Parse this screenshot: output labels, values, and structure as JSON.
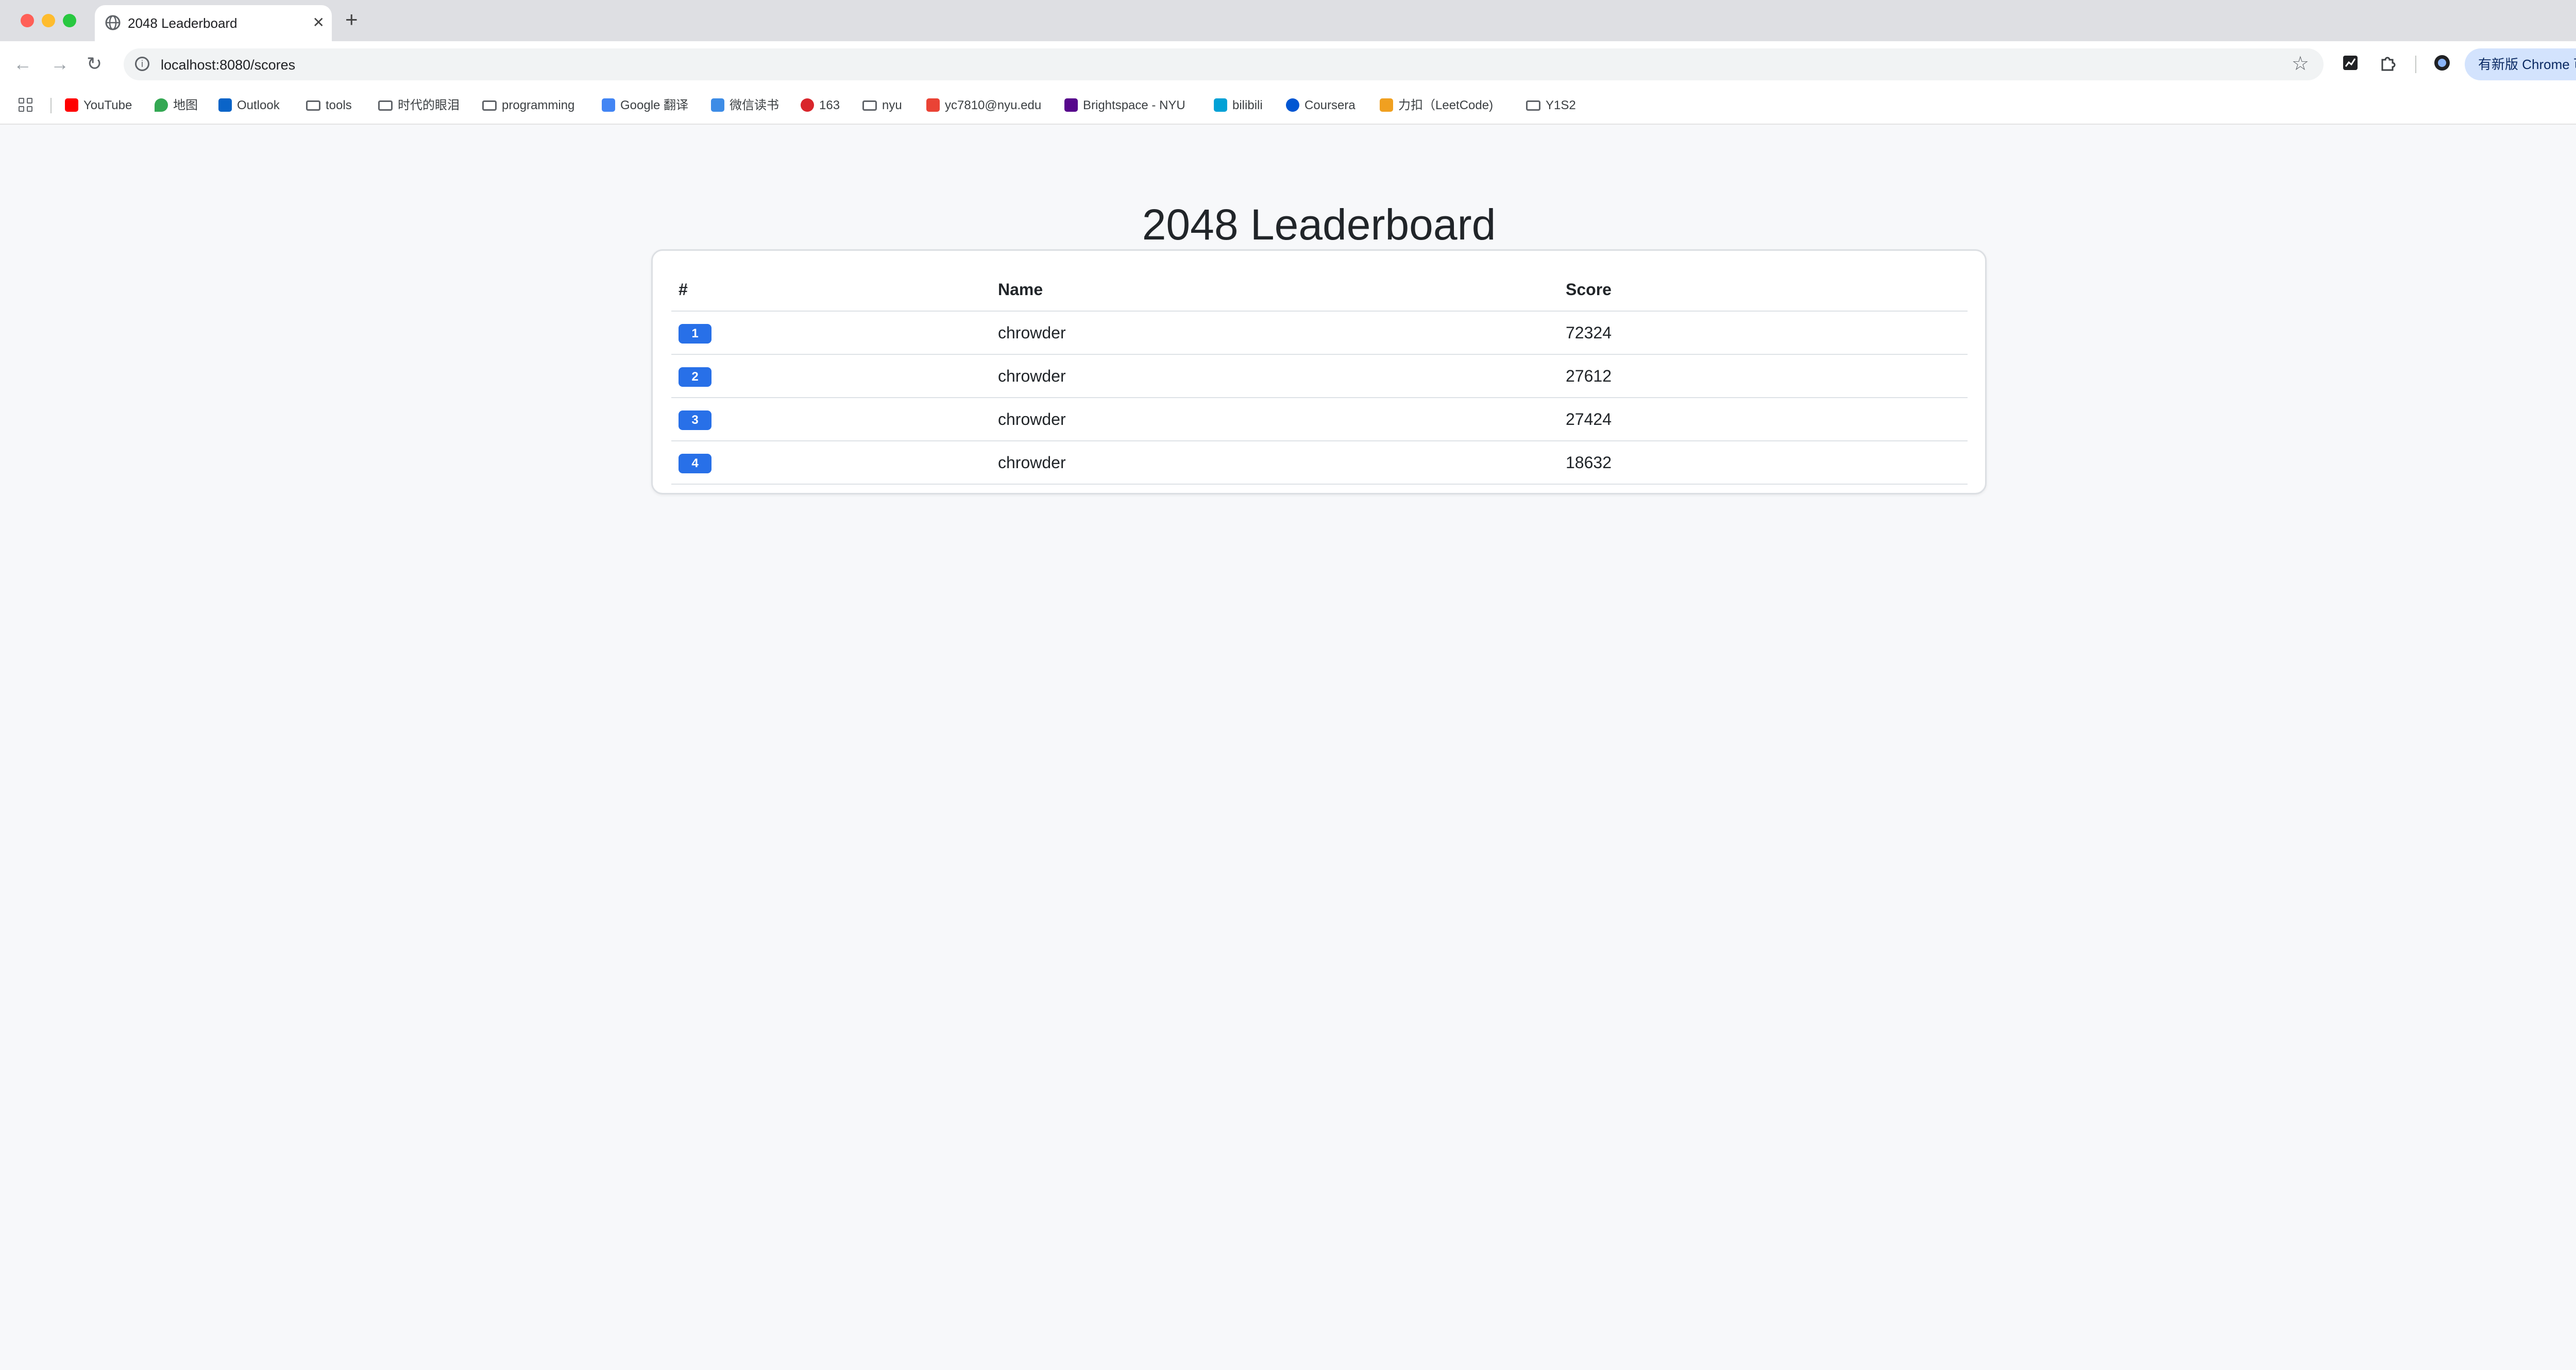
{
  "browser": {
    "tab_title": "2048 Leaderboard",
    "url": "localhost:8080/scores",
    "update_label": "有新版 Chrome 可用",
    "bookmarks": [
      {
        "label": "YouTube",
        "icon": "youtube-icon",
        "color": "#ff0000"
      },
      {
        "label": "地图",
        "icon": "maps-icon",
        "color": "#34a853"
      },
      {
        "label": "Outlook",
        "icon": "outlook-icon",
        "color": "#0a64c8"
      },
      {
        "label": "tools",
        "icon": "folder-icon"
      },
      {
        "label": "时代的眼泪",
        "icon": "folder-icon"
      },
      {
        "label": "programming",
        "icon": "folder-icon"
      },
      {
        "label": "Google 翻译",
        "icon": "google-translate-icon",
        "color": "#4285f4"
      },
      {
        "label": "微信读书",
        "icon": "weread-icon",
        "color": "#3d8ce6"
      },
      {
        "label": "163",
        "icon": "netease-icon",
        "color": "#d9262c"
      },
      {
        "label": "nyu",
        "icon": "folder-icon"
      },
      {
        "label": "yc7810@nyu.edu",
        "icon": "gmail-icon",
        "color": "#ea4335"
      },
      {
        "label": "Brightspace - NYU",
        "icon": "brightspace-icon",
        "color": "#57068c"
      },
      {
        "label": "bilibili",
        "icon": "bilibili-icon",
        "color": "#00a1d6"
      },
      {
        "label": "Coursera",
        "icon": "coursera-icon",
        "color": "#0056d2"
      },
      {
        "label": "力扣（LeetCode)",
        "icon": "leetcode-icon",
        "color": "#f0a020"
      },
      {
        "label": "Y1S2",
        "icon": "folder-icon"
      }
    ]
  },
  "page": {
    "title": "2048 Leaderboard",
    "table": {
      "headers": [
        "#",
        "Name",
        "Score"
      ],
      "rows": [
        {
          "rank": "1",
          "name": "chrowder",
          "score": "72324"
        },
        {
          "rank": "2",
          "name": "chrowder",
          "score": "27612"
        },
        {
          "rank": "3",
          "name": "chrowder",
          "score": "27424"
        },
        {
          "rank": "4",
          "name": "chrowder",
          "score": "18632"
        }
      ]
    }
  },
  "colors": {
    "accent": "#2870e8",
    "background": "#f7f8fa"
  }
}
